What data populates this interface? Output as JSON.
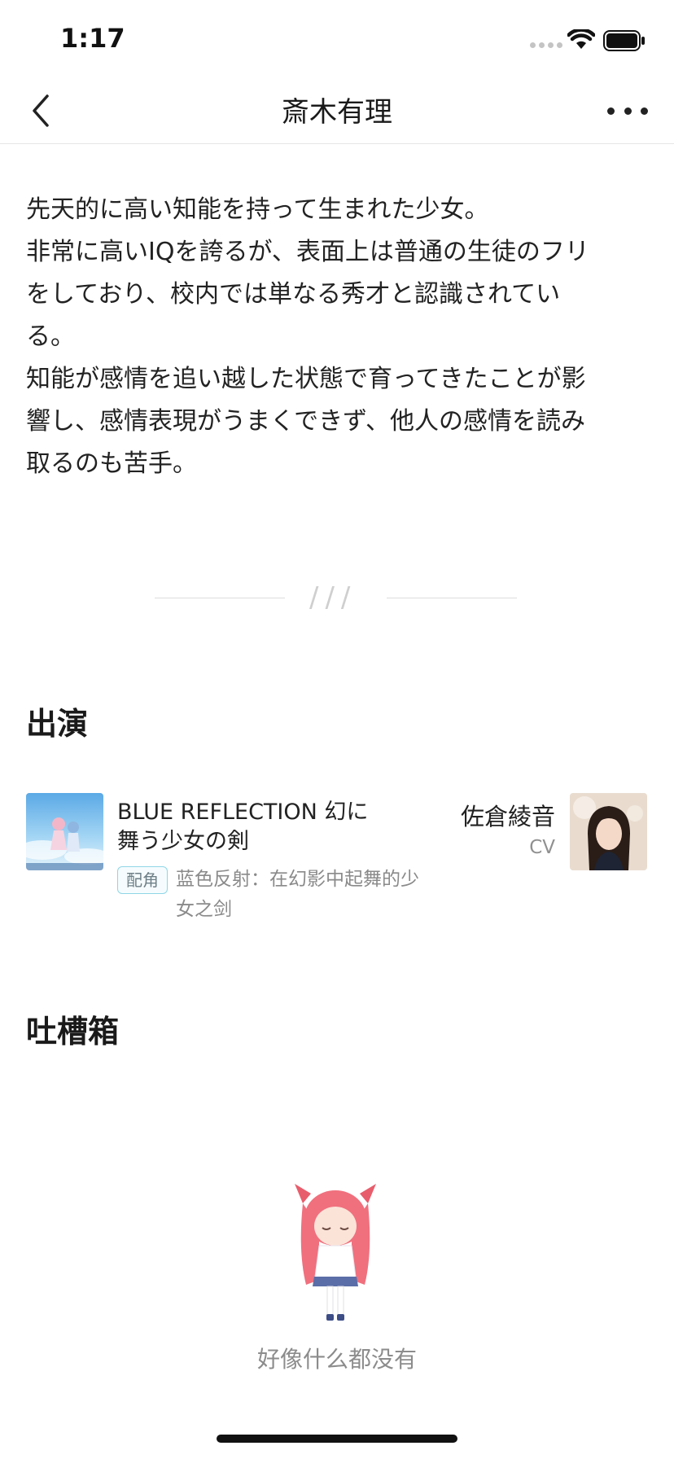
{
  "status_bar": {
    "time": "1:17",
    "icons": [
      "signal-dots-icon",
      "wifi-icon",
      "battery-icon"
    ]
  },
  "nav": {
    "title": "斎木有理",
    "back_icon": "chevron-left-icon",
    "more_icon": "more-dots-icon"
  },
  "description": {
    "lines": [
      "先天的に高い知能を持って生まれた少女。",
      "非常に高いIQを誇るが、表面上は普通の生徒のフリ",
      "をしており、校内では単なる秀才と認識されてい",
      "る。",
      "知能が感情を追い越した状態で育ってきたことが影",
      "響し、感情表現がうまくできず、他人の感情を読み",
      "取るのも苦手。"
    ]
  },
  "divider": {
    "mark": "///"
  },
  "appearances": {
    "title": "出演",
    "item": {
      "work_title_lines": [
        "BLUE REFLECTION 幻に",
        "舞う少女の剣"
      ],
      "role_tag": "配角",
      "work_subtitle_lines": [
        "蓝色反射：在幻影中起舞的少",
        "女之剑"
      ],
      "cv_name": "佐倉綾音",
      "cv_role": "CV"
    }
  },
  "comments": {
    "title": "吐槽箱",
    "empty_text": "好像什么都没有"
  },
  "colors": {
    "accent_tag_border": "#8fd6e6",
    "text_primary": "#222222",
    "text_secondary": "#8a8a8a",
    "mascot_hair": "#f0707e"
  }
}
